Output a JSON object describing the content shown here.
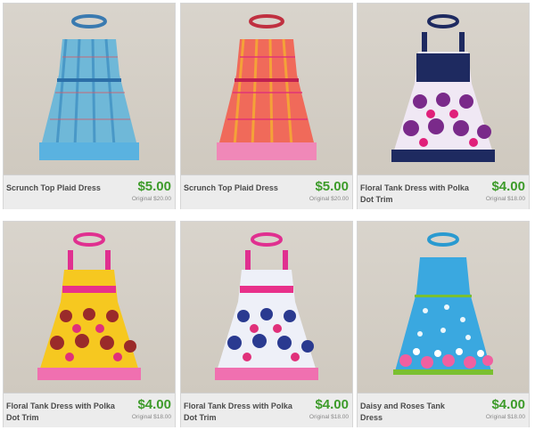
{
  "products": [
    {
      "title": "Scrunch Top Plaid Dress",
      "price": "$5.00",
      "original": "Original $20.00",
      "image": "plaid-dress-blue"
    },
    {
      "title": "Scrunch Top Plaid Dress",
      "price": "$5.00",
      "original": "Original $20.00",
      "image": "plaid-dress-pink"
    },
    {
      "title": "Floral Tank Dress with Polka Dot Trim",
      "price": "$4.00",
      "original": "Original $18.00",
      "image": "floral-dress-purple"
    },
    {
      "title": "Floral Tank Dress with Polka Dot Trim",
      "price": "$4.00",
      "original": "Original $18.00",
      "image": "floral-dress-yellow"
    },
    {
      "title": "Floral Tank Dress with Polka Dot Trim",
      "price": "$4.00",
      "original": "Original $18.00",
      "image": "floral-dress-blue"
    },
    {
      "title": "Daisy and Roses Tank Dress",
      "price": "$4.00",
      "original": "Original $18.00",
      "image": "daisy-roses-dress"
    }
  ],
  "colors": {
    "price": "#3d9b2a",
    "background": "#ffffff"
  }
}
